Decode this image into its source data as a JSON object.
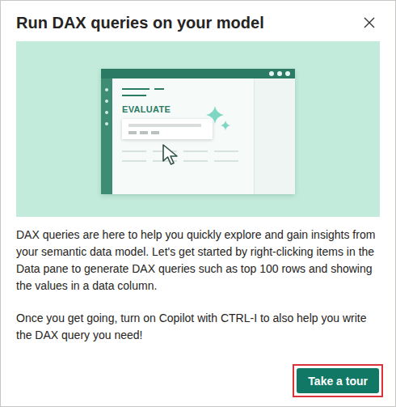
{
  "dialog": {
    "title": "Run DAX queries on your model"
  },
  "illustration": {
    "label": "EVALUATE"
  },
  "paragraphs": [
    "DAX queries are here to help you quickly explore and gain insights from your semantic data model. Let's get started by right-clicking items in the Data pane to generate DAX queries such as top 100 rows and showing the values in a data column.",
    "Once you get going, turn on Copilot with CTRL-I to also help you write the DAX query you need!"
  ],
  "button": {
    "label": "Take a tour",
    "highlighted": true
  }
}
